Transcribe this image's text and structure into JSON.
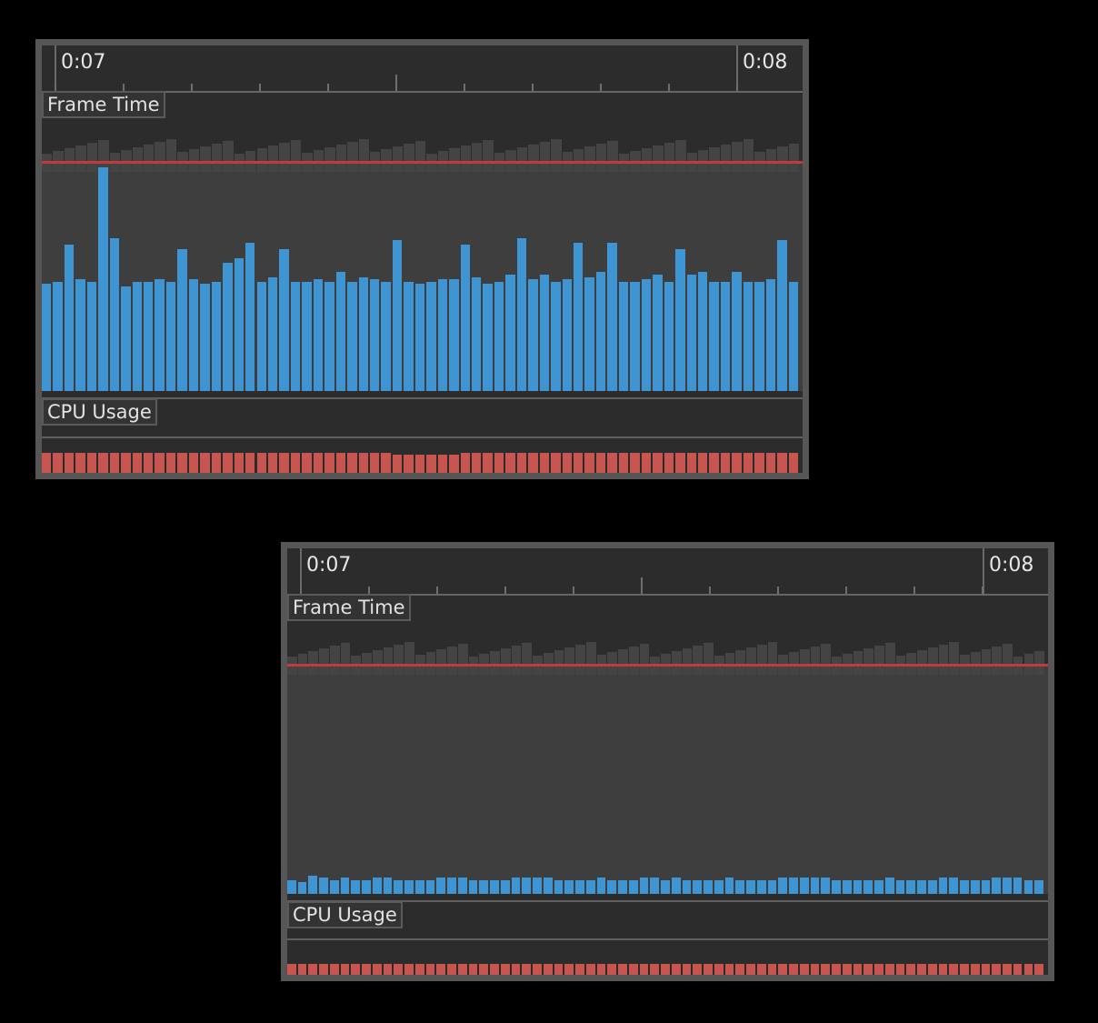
{
  "panels": [
    {
      "id": "before",
      "timeline": {
        "start_label": "0:07",
        "end_label": "0:08"
      },
      "frame_time": {
        "label": "Frame Time",
        "bars": [
          0.47,
          0.48,
          0.64,
          0.49,
          0.48,
          0.98,
          0.67,
          0.46,
          0.48,
          0.48,
          0.49,
          0.48,
          0.62,
          0.49,
          0.47,
          0.48,
          0.56,
          0.58,
          0.65,
          0.48,
          0.5,
          0.62,
          0.48,
          0.48,
          0.49,
          0.48,
          0.52,
          0.48,
          0.5,
          0.49,
          0.48,
          0.66,
          0.48,
          0.47,
          0.48,
          0.49,
          0.49,
          0.64,
          0.5,
          0.47,
          0.48,
          0.51,
          0.67,
          0.49,
          0.51,
          0.48,
          0.49,
          0.65,
          0.5,
          0.52,
          0.65,
          0.48,
          0.48,
          0.49,
          0.51,
          0.48,
          0.62,
          0.51,
          0.52,
          0.48,
          0.48,
          0.52,
          0.48,
          0.48,
          0.49,
          0.66,
          0.48
        ]
      },
      "cpu_usage": {
        "label": "CPU Usage",
        "bars": [
          0.92,
          0.92,
          0.92,
          0.92,
          0.92,
          0.92,
          0.92,
          0.92,
          0.92,
          0.92,
          0.92,
          0.92,
          0.92,
          0.92,
          0.92,
          0.92,
          0.92,
          0.92,
          0.92,
          0.92,
          0.92,
          0.92,
          0.92,
          0.92,
          0.92,
          0.92,
          0.92,
          0.92,
          0.92,
          0.92,
          0.92,
          0.85,
          0.85,
          0.85,
          0.85,
          0.85,
          0.85,
          0.92,
          0.92,
          0.92,
          0.92,
          0.92,
          0.92,
          0.92,
          0.92,
          0.92,
          0.92,
          0.92,
          0.92,
          0.92,
          0.92,
          0.92,
          0.92,
          0.92,
          0.92,
          0.92,
          0.92,
          0.92,
          0.92,
          0.92,
          0.92,
          0.92,
          0.92,
          0.92,
          0.92,
          0.92,
          0.92
        ]
      }
    },
    {
      "id": "after",
      "timeline": {
        "start_label": "0:07",
        "end_label": "0:08"
      },
      "frame_time": {
        "label": "Frame Time",
        "bars": [
          0.06,
          0.05,
          0.08,
          0.07,
          0.06,
          0.07,
          0.06,
          0.06,
          0.07,
          0.07,
          0.06,
          0.06,
          0.06,
          0.06,
          0.07,
          0.07,
          0.07,
          0.06,
          0.06,
          0.06,
          0.06,
          0.07,
          0.07,
          0.07,
          0.07,
          0.06,
          0.06,
          0.06,
          0.06,
          0.07,
          0.06,
          0.06,
          0.06,
          0.07,
          0.07,
          0.06,
          0.07,
          0.06,
          0.06,
          0.06,
          0.06,
          0.07,
          0.06,
          0.06,
          0.06,
          0.06,
          0.07,
          0.07,
          0.07,
          0.07,
          0.07,
          0.06,
          0.06,
          0.06,
          0.06,
          0.06,
          0.07,
          0.06,
          0.06,
          0.06,
          0.06,
          0.07,
          0.07,
          0.06,
          0.06,
          0.06,
          0.07,
          0.07,
          0.07,
          0.06,
          0.06
        ]
      },
      "cpu_usage": {
        "label": "CPU Usage",
        "bars": [
          1,
          1,
          1,
          1,
          1,
          1,
          1,
          1,
          1,
          1,
          1,
          1,
          1,
          1,
          1,
          1,
          1,
          1,
          1,
          1,
          1,
          1,
          1,
          1,
          1,
          1,
          1,
          1,
          1,
          1,
          1,
          1,
          1,
          1,
          1,
          1,
          1,
          1,
          1,
          1,
          1,
          1,
          1,
          1,
          1,
          1,
          1,
          1,
          1,
          1,
          1,
          1,
          1,
          1,
          1,
          1,
          1,
          1,
          1,
          1,
          1,
          1,
          1,
          1,
          1,
          1,
          1,
          1,
          1,
          1,
          1
        ]
      }
    }
  ],
  "colors": {
    "frame_bar": "#3f95d2",
    "cpu_bar": "#c75550",
    "target_line": "#c23a3a"
  }
}
